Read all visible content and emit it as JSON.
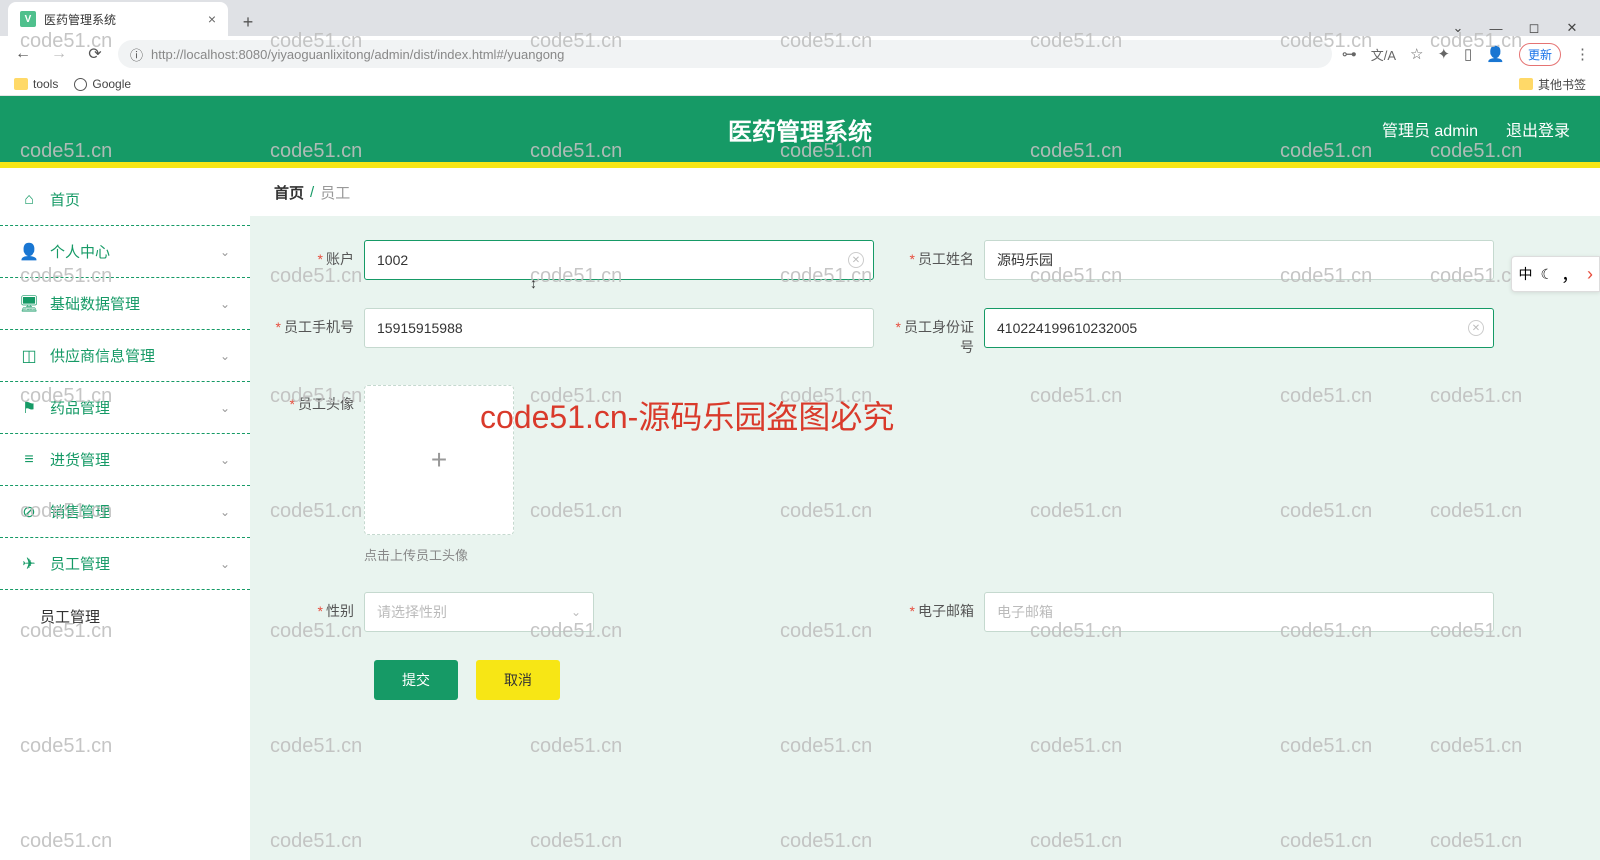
{
  "browser": {
    "tab_title": "医药管理系统",
    "url": "http://localhost:8080/yiyaoguanlixitong/admin/dist/index.html#/yuangong",
    "update_label": "更新",
    "bookmarks": {
      "tools": "tools",
      "google": "Google",
      "other": "其他书签"
    }
  },
  "header": {
    "title": "医药管理系统",
    "user_label": "管理员 admin",
    "logout": "退出登录"
  },
  "sidebar": {
    "home": "首页",
    "personal": "个人中心",
    "basic_data": "基础数据管理",
    "supplier": "供应商信息管理",
    "medicine": "药品管理",
    "purchase": "进货管理",
    "sales": "销售管理",
    "staff": "员工管理",
    "staff_sub": "员工管理"
  },
  "breadcrumb": {
    "home": "首页",
    "current": "员工"
  },
  "form": {
    "account_label": "账户",
    "account_value": "1002",
    "name_label": "员工姓名",
    "name_value": "源码乐园",
    "phone_label": "员工手机号",
    "phone_value": "15915915988",
    "idcard_label": "员工身份证号",
    "idcard_value": "410224199610232005",
    "avatar_label": "员工头像",
    "avatar_hint": "点击上传员工头像",
    "gender_label": "性别",
    "gender_placeholder": "请选择性别",
    "email_label": "电子邮箱",
    "email_placeholder": "电子邮箱",
    "submit": "提交",
    "cancel": "取消"
  },
  "watermark_text": "code51.cn",
  "big_watermark": "code51.cn-源码乐园盗图必究",
  "float": {
    "zh": "中"
  }
}
